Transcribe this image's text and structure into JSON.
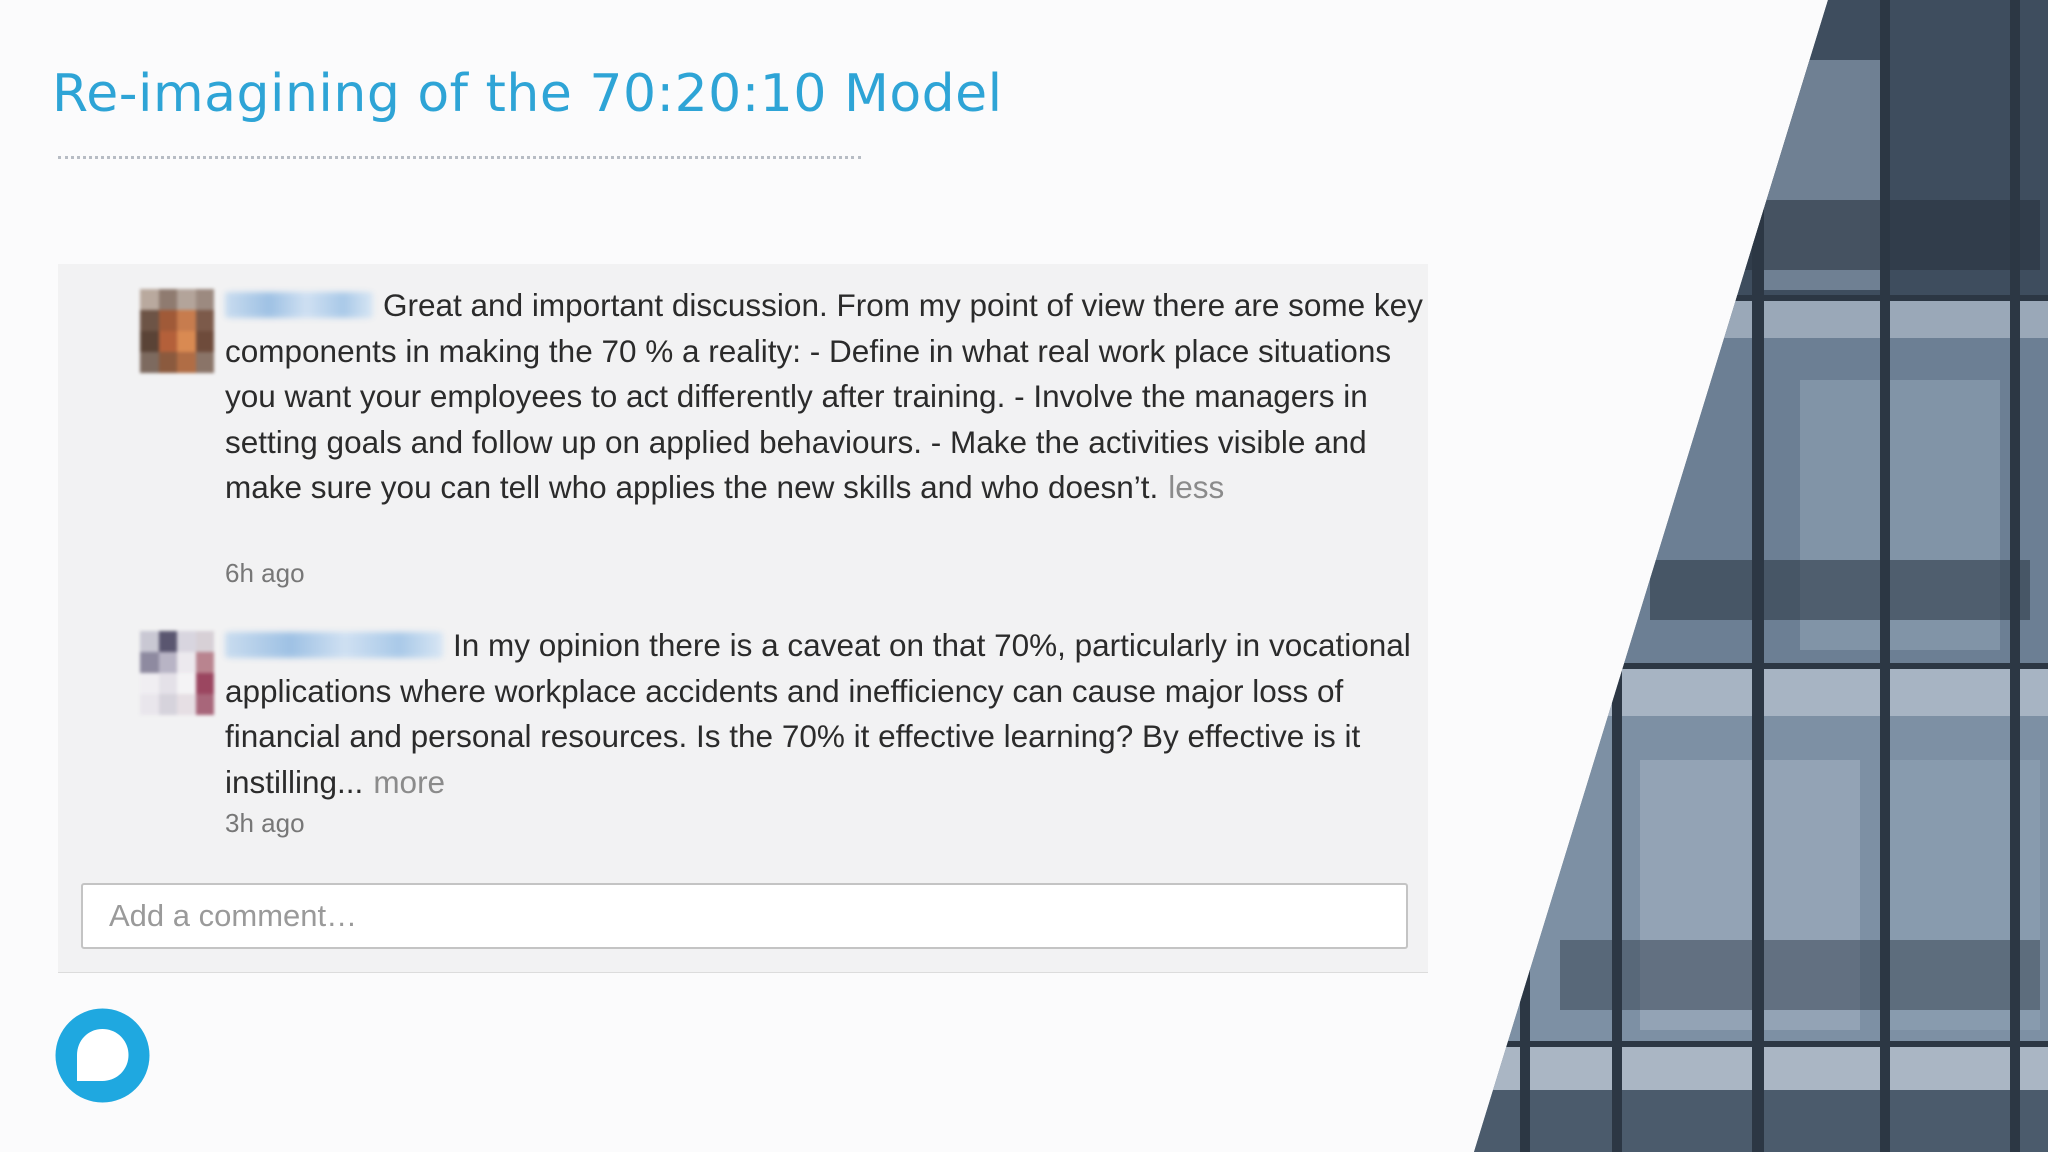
{
  "slide": {
    "title": "Re-imagining of the 70:20:10 Model"
  },
  "comments": [
    {
      "text": "Great and important discussion. From my point of view there are some key components in making the 70 % a reality: - Define in what real work place situations you want your employees to act differently after training. - Involve the managers in setting goals and follow up on applied behaviours. - Make the activities visible and make sure you can tell who applies the new skills and who doesn’t.",
      "toggle": "less",
      "time": "6h ago"
    },
    {
      "text": "In my opinion there is a caveat on that 70%, particularly in vocational applications where workplace accidents and inefficiency can cause major loss of financial and personal resources. Is the 70% it effective learning? By effective is it instilling...",
      "toggle": "more",
      "time": "3h ago"
    }
  ],
  "comment_box": {
    "placeholder": "Add a comment…"
  },
  "colors": {
    "accent": "#2ea4d6",
    "logo": "#1fa8e0",
    "panel": "#f2f2f3"
  },
  "icons": {
    "logo": "speech-bubble-logo-icon"
  }
}
